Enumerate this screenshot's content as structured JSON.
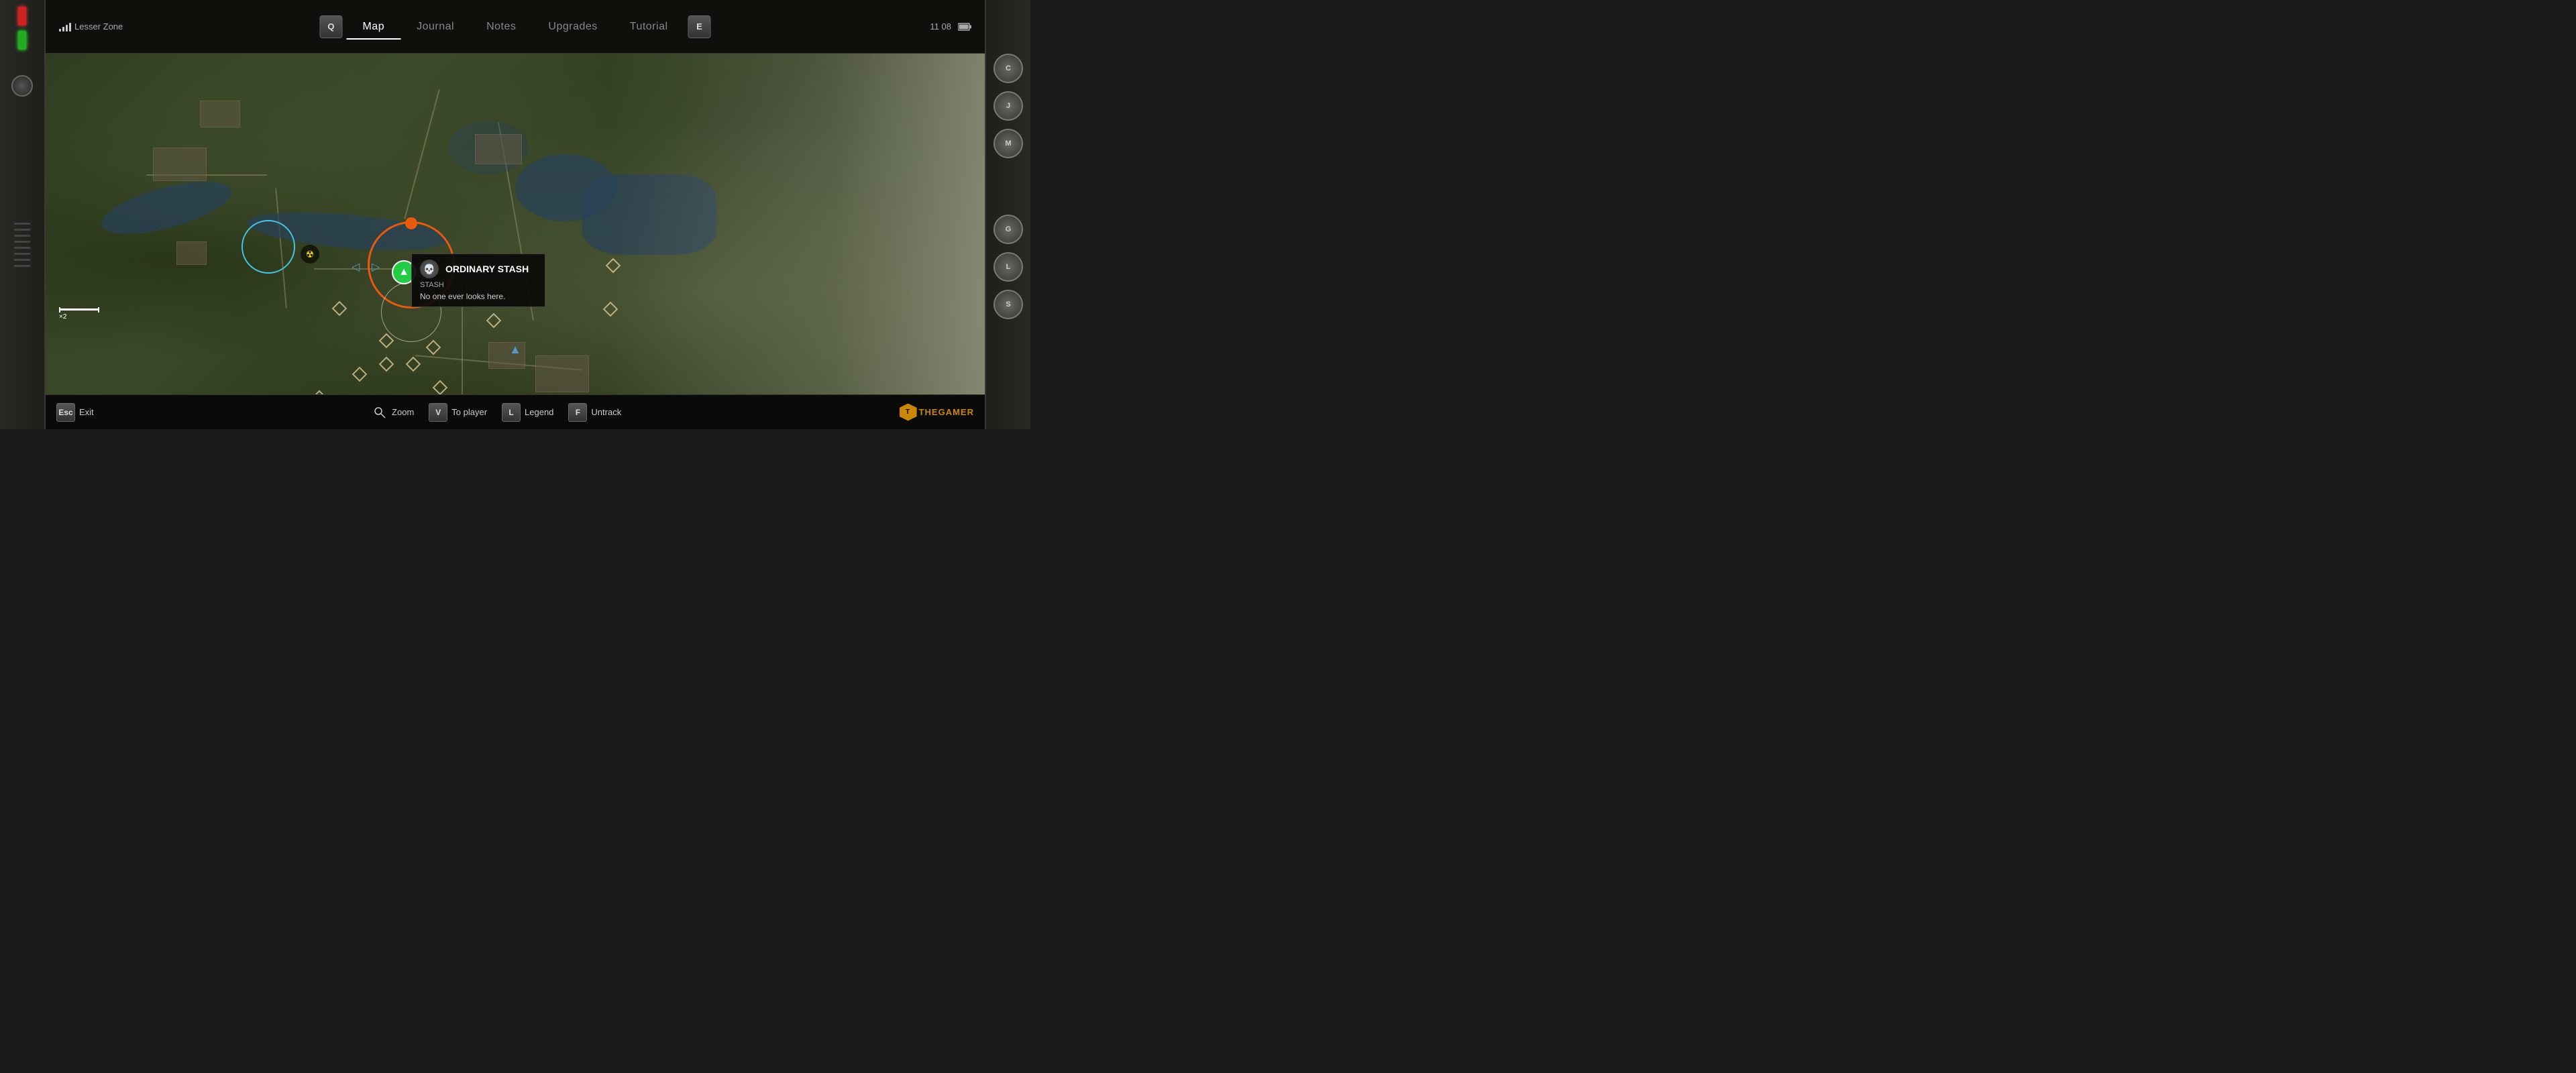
{
  "header": {
    "location": "Lesser Zone",
    "time": "11 08",
    "tabs": [
      {
        "id": "q-key",
        "label": "Q",
        "is_key": true
      },
      {
        "id": "map",
        "label": "Map",
        "active": true
      },
      {
        "id": "journal",
        "label": "Journal"
      },
      {
        "id": "notes",
        "label": "Notes"
      },
      {
        "id": "upgrades",
        "label": "Upgrades"
      },
      {
        "id": "tutorial",
        "label": "Tutorial"
      },
      {
        "id": "e-key",
        "label": "E",
        "is_key": true
      }
    ]
  },
  "map": {
    "scale_label": "×2",
    "orange_circle_label": "ORDINARY STASH",
    "stash": {
      "title": "ORDINARY STASH",
      "subtitle": "STASH",
      "description": "No one ever looks here."
    },
    "markers": {
      "radiation": "☢",
      "player_arrow": "▲",
      "skull": "💀"
    }
  },
  "bottom_bar": {
    "keys": [
      {
        "key": "Esc",
        "label": "Exit"
      },
      {
        "key": "V",
        "label": "To player"
      },
      {
        "key": "L",
        "label": "Legend"
      },
      {
        "key": "F",
        "label": "Untrack"
      }
    ],
    "zoom_label": "Zoom",
    "logo_text": "THEGAMER"
  },
  "right_buttons": [
    "C",
    "J",
    "M",
    "G",
    "L",
    "S"
  ],
  "indicators": {
    "red": "red",
    "green": "green"
  }
}
